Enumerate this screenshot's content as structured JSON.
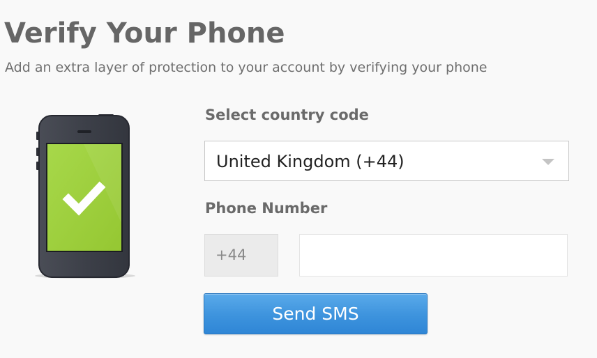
{
  "header": {
    "title": "Verify Your Phone",
    "subtitle": "Add an extra layer of protection to your account by verifying your phone"
  },
  "illustration": {
    "icon": "smartphone-checkmark-icon",
    "screen_color": "#9ccf3a",
    "body_color": "#3d4049"
  },
  "form": {
    "country_label": "Select country code",
    "country_value": "United Kingdom (+44)",
    "phone_label": "Phone Number",
    "dial_prefix": "+44",
    "phone_value": "",
    "phone_placeholder": "",
    "submit_label": "Send SMS"
  },
  "colors": {
    "button": "#3d93dd",
    "heading": "#666666"
  }
}
